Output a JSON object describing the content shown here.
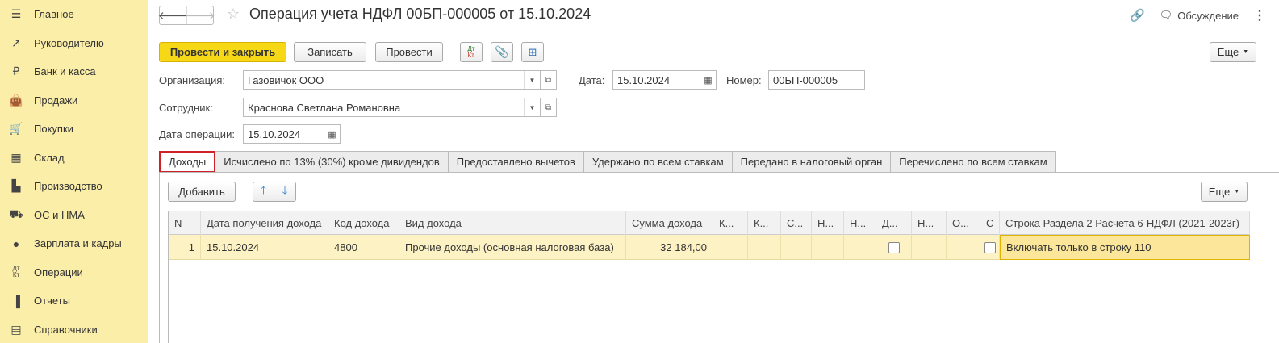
{
  "sidebar": {
    "items": [
      {
        "label": "Главное",
        "icon": "menu-icon"
      },
      {
        "label": "Руководителю",
        "icon": "trend-icon"
      },
      {
        "label": "Банк и касса",
        "icon": "ruble-icon"
      },
      {
        "label": "Продажи",
        "icon": "bag-icon"
      },
      {
        "label": "Покупки",
        "icon": "cart-icon"
      },
      {
        "label": "Склад",
        "icon": "warehouse-icon"
      },
      {
        "label": "Производство",
        "icon": "factory-icon"
      },
      {
        "label": "ОС и НМА",
        "icon": "truck-icon"
      },
      {
        "label": "Зарплата и кадры",
        "icon": "person-icon"
      },
      {
        "label": "Операции",
        "icon": "dt-kt-icon"
      },
      {
        "label": "Отчеты",
        "icon": "bar-chart-icon"
      },
      {
        "label": "Справочники",
        "icon": "book-icon"
      }
    ]
  },
  "header": {
    "title": "Операция учета НДФЛ 00БП-000005 от 15.10.2024",
    "discussion": "Обсуждение"
  },
  "toolbar": {
    "post_close": "Провести и закрыть",
    "save": "Записать",
    "post": "Провести",
    "more": "Еще",
    "dtkt_top": "Дт",
    "dtkt_bottom": "Кт"
  },
  "form": {
    "org_label": "Организация:",
    "org_value": "Газовичок ООО",
    "date_label": "Дата:",
    "date_value": "15.10.2024",
    "number_label": "Номер:",
    "number_value": "00БП-000005",
    "employee_label": "Сотрудник:",
    "employee_value": "Краснова Светлана Романовна",
    "opdate_label": "Дата операции:",
    "opdate_value": "15.10.2024"
  },
  "tabs": [
    "Доходы",
    "Исчислено по 13% (30%) кроме дивидендов",
    "Предоставлено вычетов",
    "Удержано по всем ставкам",
    "Передано в налоговый орган",
    "Перечислено по всем ставкам"
  ],
  "panel": {
    "add": "Добавить",
    "more": "Еще"
  },
  "table": {
    "columns": [
      "N",
      "Дата получения дохода",
      "Код дохода",
      "Вид дохода",
      "Сумма дохода",
      "К...",
      "К...",
      "С...",
      "Н...",
      "Н...",
      "Д...",
      "Н...",
      "О...",
      "С",
      "Строка Раздела 2 Расчета 6-НДФЛ (2021-2023г)"
    ],
    "rows": [
      {
        "n": "1",
        "date": "15.10.2024",
        "code": "4800",
        "kind": "Прочие доходы (основная налоговая база)",
        "sum": "32 184,00",
        "line": "Включать только в строку 110"
      }
    ]
  }
}
